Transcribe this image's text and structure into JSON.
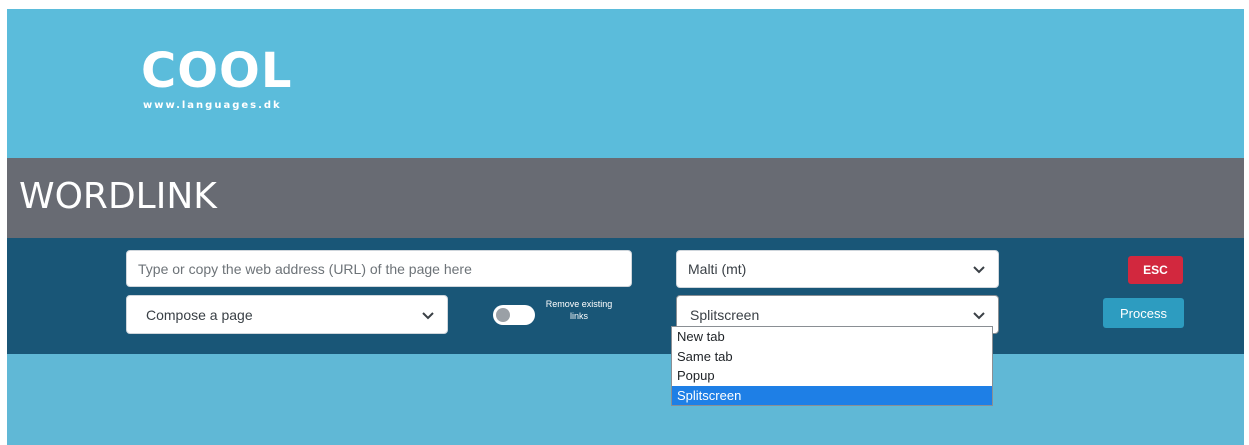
{
  "logo": {
    "text": "COOL",
    "subtext": "www.languages.dk"
  },
  "title": "WORDLINK",
  "url_input": {
    "placeholder": "Type or copy the web address (URL) of the page here",
    "value": ""
  },
  "compose_select": {
    "selected": "Compose a page"
  },
  "remove_links": {
    "label": "Remove existing links",
    "enabled": false
  },
  "language_select": {
    "selected": "Malti (mt)"
  },
  "open_mode_select": {
    "selected": "Splitscreen",
    "options": [
      "New tab",
      "Same tab",
      "Popup",
      "Splitscreen"
    ]
  },
  "buttons": {
    "esc_label": "ESC",
    "process_label": "Process"
  },
  "colors": {
    "top_band": "#5bbcdb",
    "title_band": "#686b73",
    "control_band": "#195677",
    "esc": "#d2283e",
    "process": "#2d9cc0",
    "selection": "#1e7fe6"
  },
  "icons": {
    "select_arrow": "chevron-down-icon",
    "toggle": "toggle-switch"
  }
}
